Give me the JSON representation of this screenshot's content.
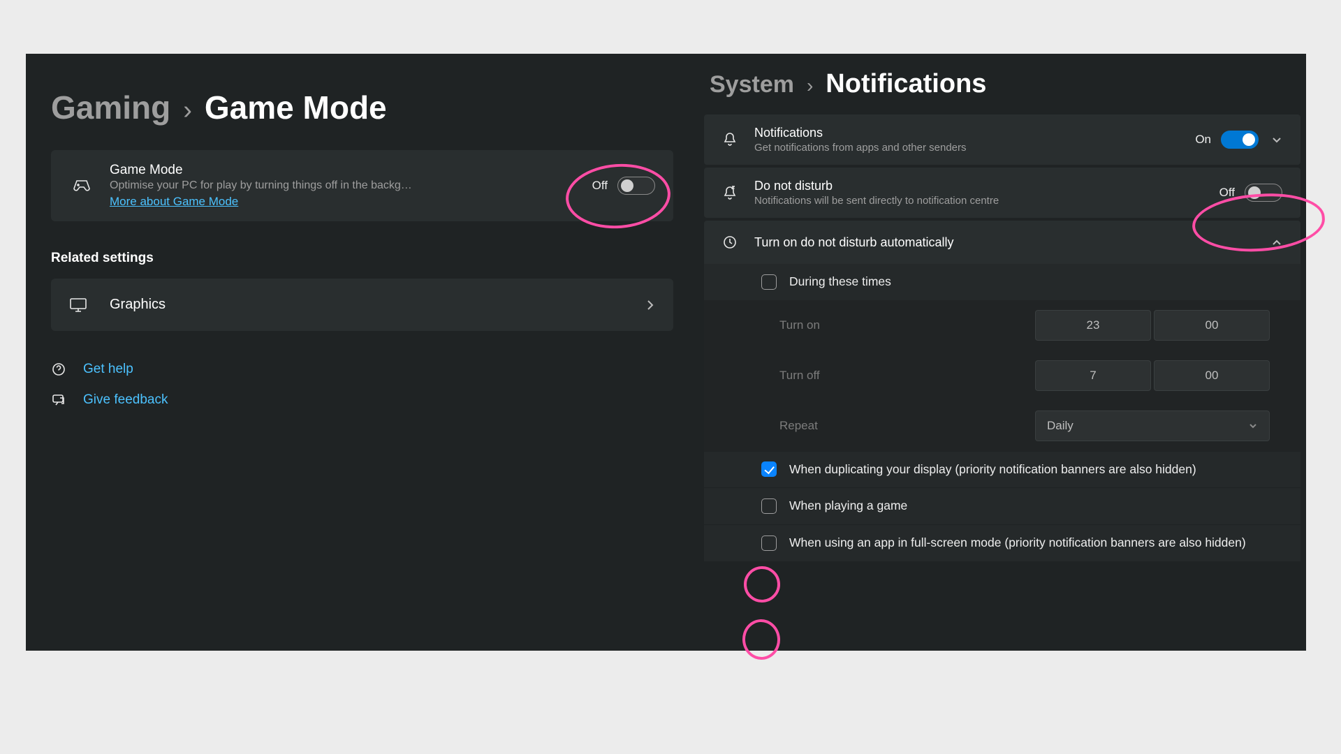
{
  "left": {
    "breadcrumb": {
      "parent": "Gaming",
      "sep": "›",
      "current": "Game Mode"
    },
    "gameMode": {
      "title": "Game Mode",
      "desc": "Optimise your PC for play by turning things off in the backg…",
      "link": "More about Game Mode",
      "toggle": {
        "state": "Off",
        "on": false
      }
    },
    "related": {
      "heading": "Related settings",
      "graphics": "Graphics"
    },
    "help": {
      "getHelp": "Get help",
      "feedback": "Give feedback"
    }
  },
  "right": {
    "breadcrumb": {
      "parent": "System",
      "sep": "›",
      "current": "Notifications"
    },
    "notifications": {
      "title": "Notifications",
      "desc": "Get notifications from apps and other senders",
      "toggle": {
        "state": "On",
        "on": true
      }
    },
    "dnd": {
      "title": "Do not disturb",
      "desc": "Notifications will be sent directly to notification centre",
      "toggle": {
        "state": "Off",
        "on": false
      }
    },
    "autoDnd": {
      "title": "Turn on do not disturb automatically",
      "duringTimes": {
        "label": "During these times",
        "checked": false
      },
      "turnOn": {
        "label": "Turn on",
        "h": "23",
        "m": "00"
      },
      "turnOff": {
        "label": "Turn off",
        "h": "7",
        "m": "00"
      },
      "repeat": {
        "label": "Repeat",
        "value": "Daily"
      },
      "dupDisplay": {
        "label": "When duplicating your display (priority notification banners are also hidden)",
        "checked": true
      },
      "playingGame": {
        "label": "When playing a game",
        "checked": false
      },
      "fullscreen": {
        "label": "When using an app in full-screen mode (priority notification banners are also hidden)",
        "checked": false
      }
    }
  },
  "annotations": {
    "color": "#ff4da6"
  }
}
